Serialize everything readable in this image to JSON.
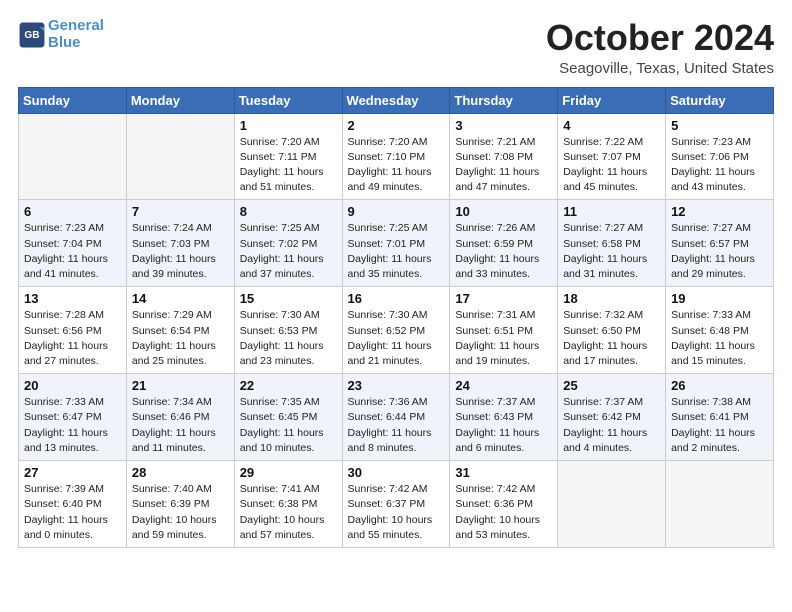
{
  "header": {
    "logo_line1": "General",
    "logo_line2": "Blue",
    "month_title": "October 2024",
    "location": "Seagoville, Texas, United States"
  },
  "weekdays": [
    "Sunday",
    "Monday",
    "Tuesday",
    "Wednesday",
    "Thursday",
    "Friday",
    "Saturday"
  ],
  "weeks": [
    [
      {
        "day": "",
        "info": ""
      },
      {
        "day": "",
        "info": ""
      },
      {
        "day": "1",
        "info": "Sunrise: 7:20 AM\nSunset: 7:11 PM\nDaylight: 11 hours and 51 minutes."
      },
      {
        "day": "2",
        "info": "Sunrise: 7:20 AM\nSunset: 7:10 PM\nDaylight: 11 hours and 49 minutes."
      },
      {
        "day": "3",
        "info": "Sunrise: 7:21 AM\nSunset: 7:08 PM\nDaylight: 11 hours and 47 minutes."
      },
      {
        "day": "4",
        "info": "Sunrise: 7:22 AM\nSunset: 7:07 PM\nDaylight: 11 hours and 45 minutes."
      },
      {
        "day": "5",
        "info": "Sunrise: 7:23 AM\nSunset: 7:06 PM\nDaylight: 11 hours and 43 minutes."
      }
    ],
    [
      {
        "day": "6",
        "info": "Sunrise: 7:23 AM\nSunset: 7:04 PM\nDaylight: 11 hours and 41 minutes."
      },
      {
        "day": "7",
        "info": "Sunrise: 7:24 AM\nSunset: 7:03 PM\nDaylight: 11 hours and 39 minutes."
      },
      {
        "day": "8",
        "info": "Sunrise: 7:25 AM\nSunset: 7:02 PM\nDaylight: 11 hours and 37 minutes."
      },
      {
        "day": "9",
        "info": "Sunrise: 7:25 AM\nSunset: 7:01 PM\nDaylight: 11 hours and 35 minutes."
      },
      {
        "day": "10",
        "info": "Sunrise: 7:26 AM\nSunset: 6:59 PM\nDaylight: 11 hours and 33 minutes."
      },
      {
        "day": "11",
        "info": "Sunrise: 7:27 AM\nSunset: 6:58 PM\nDaylight: 11 hours and 31 minutes."
      },
      {
        "day": "12",
        "info": "Sunrise: 7:27 AM\nSunset: 6:57 PM\nDaylight: 11 hours and 29 minutes."
      }
    ],
    [
      {
        "day": "13",
        "info": "Sunrise: 7:28 AM\nSunset: 6:56 PM\nDaylight: 11 hours and 27 minutes."
      },
      {
        "day": "14",
        "info": "Sunrise: 7:29 AM\nSunset: 6:54 PM\nDaylight: 11 hours and 25 minutes."
      },
      {
        "day": "15",
        "info": "Sunrise: 7:30 AM\nSunset: 6:53 PM\nDaylight: 11 hours and 23 minutes."
      },
      {
        "day": "16",
        "info": "Sunrise: 7:30 AM\nSunset: 6:52 PM\nDaylight: 11 hours and 21 minutes."
      },
      {
        "day": "17",
        "info": "Sunrise: 7:31 AM\nSunset: 6:51 PM\nDaylight: 11 hours and 19 minutes."
      },
      {
        "day": "18",
        "info": "Sunrise: 7:32 AM\nSunset: 6:50 PM\nDaylight: 11 hours and 17 minutes."
      },
      {
        "day": "19",
        "info": "Sunrise: 7:33 AM\nSunset: 6:48 PM\nDaylight: 11 hours and 15 minutes."
      }
    ],
    [
      {
        "day": "20",
        "info": "Sunrise: 7:33 AM\nSunset: 6:47 PM\nDaylight: 11 hours and 13 minutes."
      },
      {
        "day": "21",
        "info": "Sunrise: 7:34 AM\nSunset: 6:46 PM\nDaylight: 11 hours and 11 minutes."
      },
      {
        "day": "22",
        "info": "Sunrise: 7:35 AM\nSunset: 6:45 PM\nDaylight: 11 hours and 10 minutes."
      },
      {
        "day": "23",
        "info": "Sunrise: 7:36 AM\nSunset: 6:44 PM\nDaylight: 11 hours and 8 minutes."
      },
      {
        "day": "24",
        "info": "Sunrise: 7:37 AM\nSunset: 6:43 PM\nDaylight: 11 hours and 6 minutes."
      },
      {
        "day": "25",
        "info": "Sunrise: 7:37 AM\nSunset: 6:42 PM\nDaylight: 11 hours and 4 minutes."
      },
      {
        "day": "26",
        "info": "Sunrise: 7:38 AM\nSunset: 6:41 PM\nDaylight: 11 hours and 2 minutes."
      }
    ],
    [
      {
        "day": "27",
        "info": "Sunrise: 7:39 AM\nSunset: 6:40 PM\nDaylight: 11 hours and 0 minutes."
      },
      {
        "day": "28",
        "info": "Sunrise: 7:40 AM\nSunset: 6:39 PM\nDaylight: 10 hours and 59 minutes."
      },
      {
        "day": "29",
        "info": "Sunrise: 7:41 AM\nSunset: 6:38 PM\nDaylight: 10 hours and 57 minutes."
      },
      {
        "day": "30",
        "info": "Sunrise: 7:42 AM\nSunset: 6:37 PM\nDaylight: 10 hours and 55 minutes."
      },
      {
        "day": "31",
        "info": "Sunrise: 7:42 AM\nSunset: 6:36 PM\nDaylight: 10 hours and 53 minutes."
      },
      {
        "day": "",
        "info": ""
      },
      {
        "day": "",
        "info": ""
      }
    ]
  ]
}
